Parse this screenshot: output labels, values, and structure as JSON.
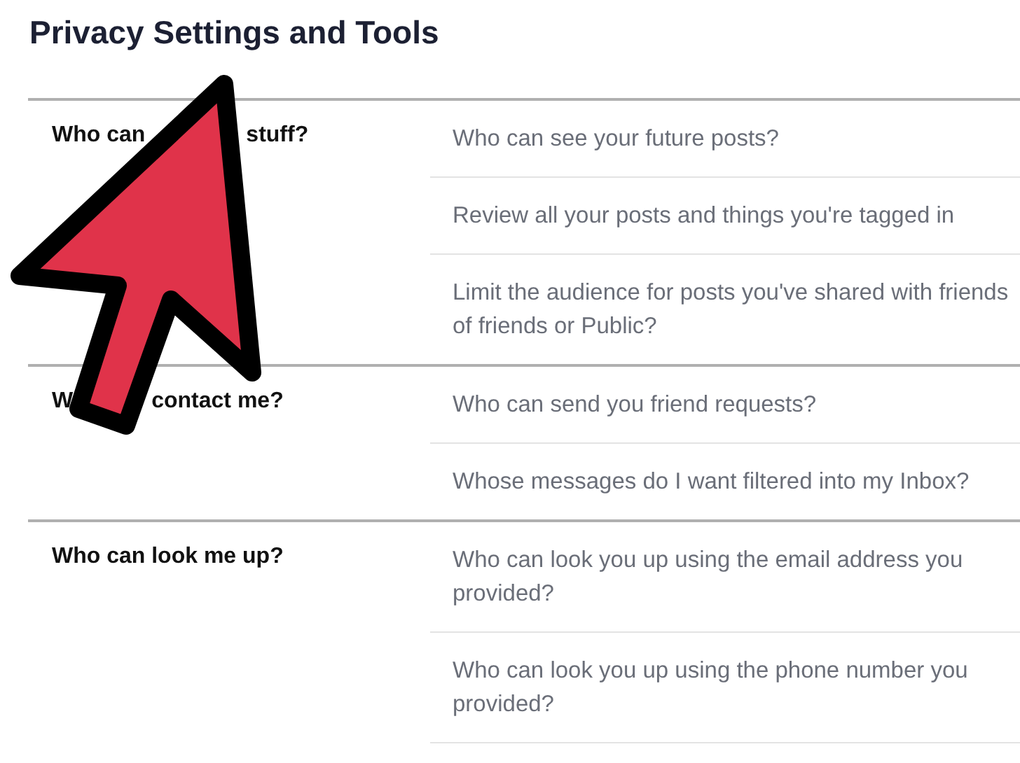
{
  "title": "Privacy Settings and Tools",
  "sections": [
    {
      "label_parts": [
        "Who can",
        "stuff?"
      ],
      "items": [
        "Who can see your future posts?",
        "Review all your posts and things you're tagged in",
        "Limit the audience for posts you've shared with friends of friends or Public?"
      ]
    },
    {
      "label_parts": [
        "W",
        "contact me?"
      ],
      "items": [
        "Who can send you friend requests?",
        "Whose messages do I want filtered into my Inbox?"
      ]
    },
    {
      "label_parts": [
        "Who can look me up?"
      ],
      "items": [
        "Who can look you up using the email address you provided?",
        "Who can look you up using the phone number you provided?"
      ]
    }
  ]
}
